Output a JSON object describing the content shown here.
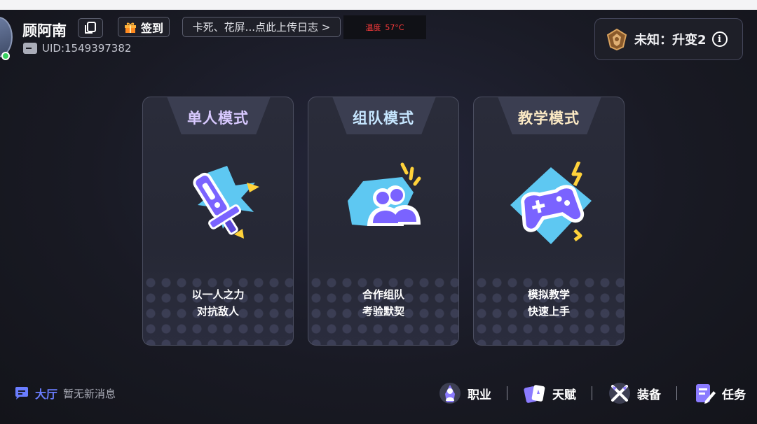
{
  "header": {
    "username": "顾阿南",
    "uid": "UID:1549397382",
    "signin_label": "签到",
    "feedback_label": "卡死、花屏...点此上传日志 >",
    "temp_label": "温度",
    "temp_value": "57°C",
    "rank_label": "未知：升变2",
    "info_symbol": "i"
  },
  "modes": [
    {
      "title": "单人模式",
      "title_color": "#d8c9ff",
      "desc_line1": "以一人之力",
      "desc_line2": "对抗敌人",
      "icon": "sword-icon"
    },
    {
      "title": "组队模式",
      "title_color": "#c6e6ff",
      "desc_line1": "合作组队",
      "desc_line2": "考验默契",
      "icon": "team-icon"
    },
    {
      "title": "教学模式",
      "title_color": "#fbe9c4",
      "desc_line1": "模拟教学",
      "desc_line2": "快速上手",
      "icon": "gamepad-icon"
    }
  ],
  "footer": {
    "lobby_label": "大厅",
    "lobby_message": "暂无新消息",
    "nav": [
      {
        "label": "职业",
        "icon": "class-icon"
      },
      {
        "label": "天赋",
        "icon": "talent-icon"
      },
      {
        "label": "装备",
        "icon": "equipment-icon"
      },
      {
        "label": "任务",
        "icon": "task-icon"
      }
    ]
  },
  "colors": {
    "accent": "#6a7dff",
    "cyan": "#5ec8f2",
    "purple": "#7a63ff",
    "yellow": "#ffd23a",
    "online": "#37d15f",
    "warning": "#ff3b3b"
  }
}
